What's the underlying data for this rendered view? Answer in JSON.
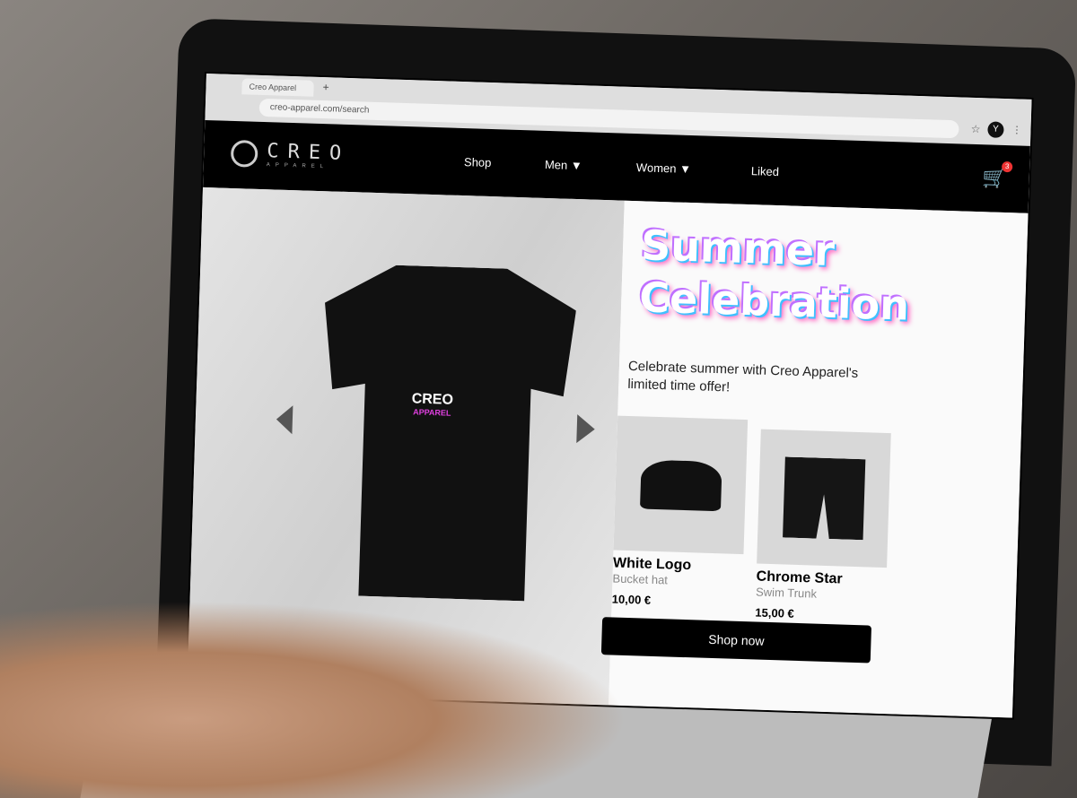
{
  "browser": {
    "tab_title": "Creo Apparel",
    "new_tab": "+",
    "url": "creo-apparel.com/search",
    "profile": "Y"
  },
  "nav": {
    "logo": "CREO",
    "logo_sub": "APPAREL",
    "items": [
      "Shop",
      "Men ▼",
      "Women ▼",
      "Liked"
    ],
    "cart_count": "3"
  },
  "hero": {
    "shirt_logo": "CREO",
    "shirt_logo_sub": "APPAREL"
  },
  "promo": {
    "title_line1": "Summer",
    "title_line2": "Celebration",
    "subtitle": "Celebrate summer with Creo Apparel's limited time offer!",
    "products": [
      {
        "name": "White Logo",
        "type": "Bucket hat",
        "price": "10,00 €"
      },
      {
        "name": "Chrome Star",
        "type": "Swim Trunk",
        "price": "15,00 €"
      }
    ],
    "cta": "Shop now"
  }
}
